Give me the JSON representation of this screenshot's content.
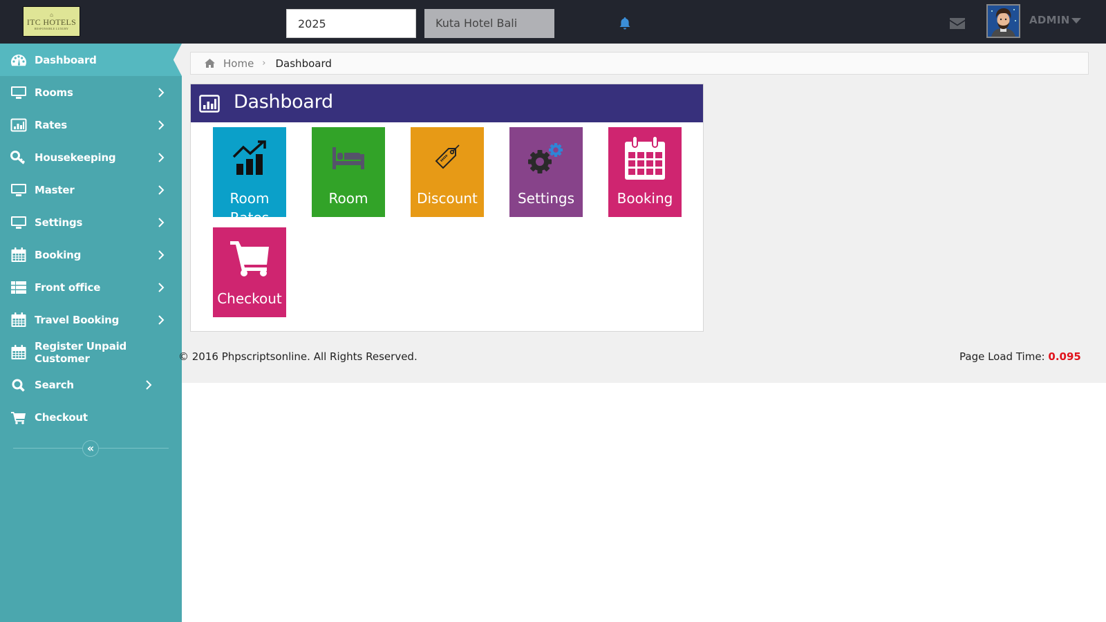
{
  "header": {
    "logo": {
      "mark": "⌂",
      "name": "ITC HOTELS",
      "tagline": "RESPONSIBLE LUXURY"
    },
    "year_value": "2025",
    "hotel_selected": "Kuta Hotel Bali",
    "user_name": "ADMIN",
    "icons": {
      "notification": "bell-icon",
      "messages": "envelope-icon",
      "user_menu": "caret-down-icon"
    }
  },
  "sidebar": {
    "items": [
      {
        "label": "Dashboard",
        "icon": "dashboard-icon",
        "active": true,
        "has_submenu": false
      },
      {
        "label": "Rooms",
        "icon": "desktop-icon",
        "has_submenu": true
      },
      {
        "label": "Rates",
        "icon": "bar-chart-icon",
        "has_submenu": true
      },
      {
        "label": "Housekeeping",
        "icon": "key-icon",
        "has_submenu": true
      },
      {
        "label": "Master",
        "icon": "desktop-icon",
        "has_submenu": true
      },
      {
        "label": "Settings",
        "icon": "desktop-icon",
        "has_submenu": true
      },
      {
        "label": "Booking",
        "icon": "calendar-icon",
        "has_submenu": true
      },
      {
        "label": "Front office",
        "icon": "list-icon",
        "has_submenu": true
      },
      {
        "label": "Travel Booking",
        "icon": "calendar-icon",
        "has_submenu": true
      },
      {
        "label": "Register Unpaid Customer",
        "icon": "calendar-icon",
        "has_submenu": false
      },
      {
        "label": "Search",
        "icon": "search-icon",
        "has_submenu": true
      },
      {
        "label": "Checkout",
        "icon": "cart-icon",
        "has_submenu": false
      }
    ],
    "collapse_label": "«"
  },
  "breadcrumb": {
    "home": "Home",
    "separator": "›",
    "current": "Dashboard"
  },
  "panel": {
    "title": "Dashboard",
    "tiles": [
      {
        "label": "Room Rates",
        "icon": "trend-chart-icon",
        "color": "#0ba0c9"
      },
      {
        "label": "Room",
        "icon": "bed-icon",
        "color": "#32a328"
      },
      {
        "label": "Discount",
        "icon": "tag-icon",
        "color": "#e79a16"
      },
      {
        "label": "Settings",
        "icon": "gears-icon",
        "color": "#87438a"
      },
      {
        "label": "Booking",
        "icon": "calendar-icon",
        "color": "#cf2570"
      },
      {
        "label": "Checkout",
        "icon": "cart-icon",
        "color": "#cf2570"
      }
    ]
  },
  "footer": {
    "copyright": "© 2016 Phpscriptsonline. All Rights Reserved.",
    "load_time_label": "Page Load Time:",
    "load_time_value": "0.095"
  }
}
